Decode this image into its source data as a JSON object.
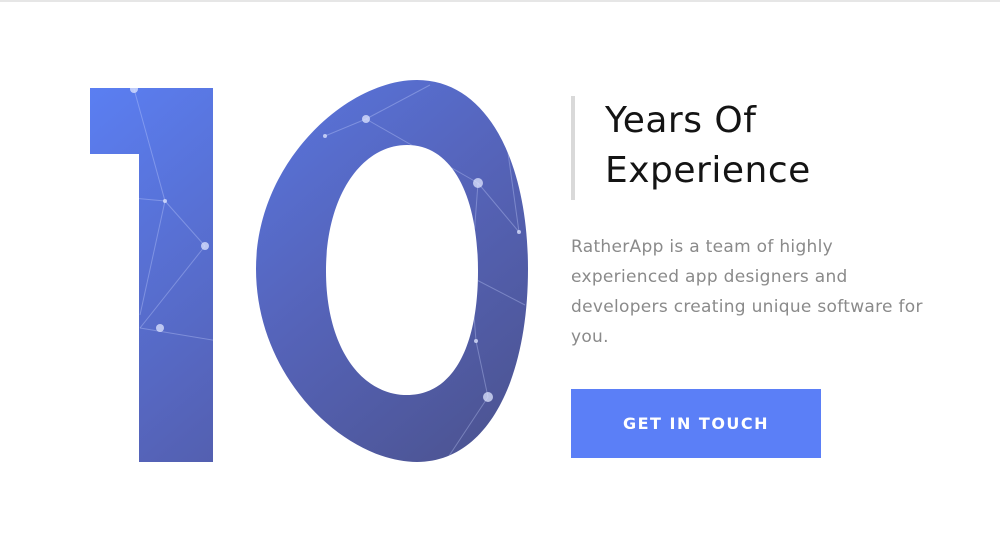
{
  "hero": {
    "number": "10",
    "heading_lines": [
      "Years Of",
      "Experience"
    ],
    "description_lines": [
      "RatherApp is a team of highly",
      "experienced app designers and",
      "developers creating unique software for",
      "you."
    ],
    "cta_label": "GET IN TOUCH"
  },
  "colors": {
    "accent": "#5b7ff7",
    "number_gradient_start": "#5b80f5",
    "number_gradient_end": "#4a5088",
    "heading": "#141414",
    "body_text": "#8a8a8a",
    "heading_rule": "#d9d9d9"
  }
}
